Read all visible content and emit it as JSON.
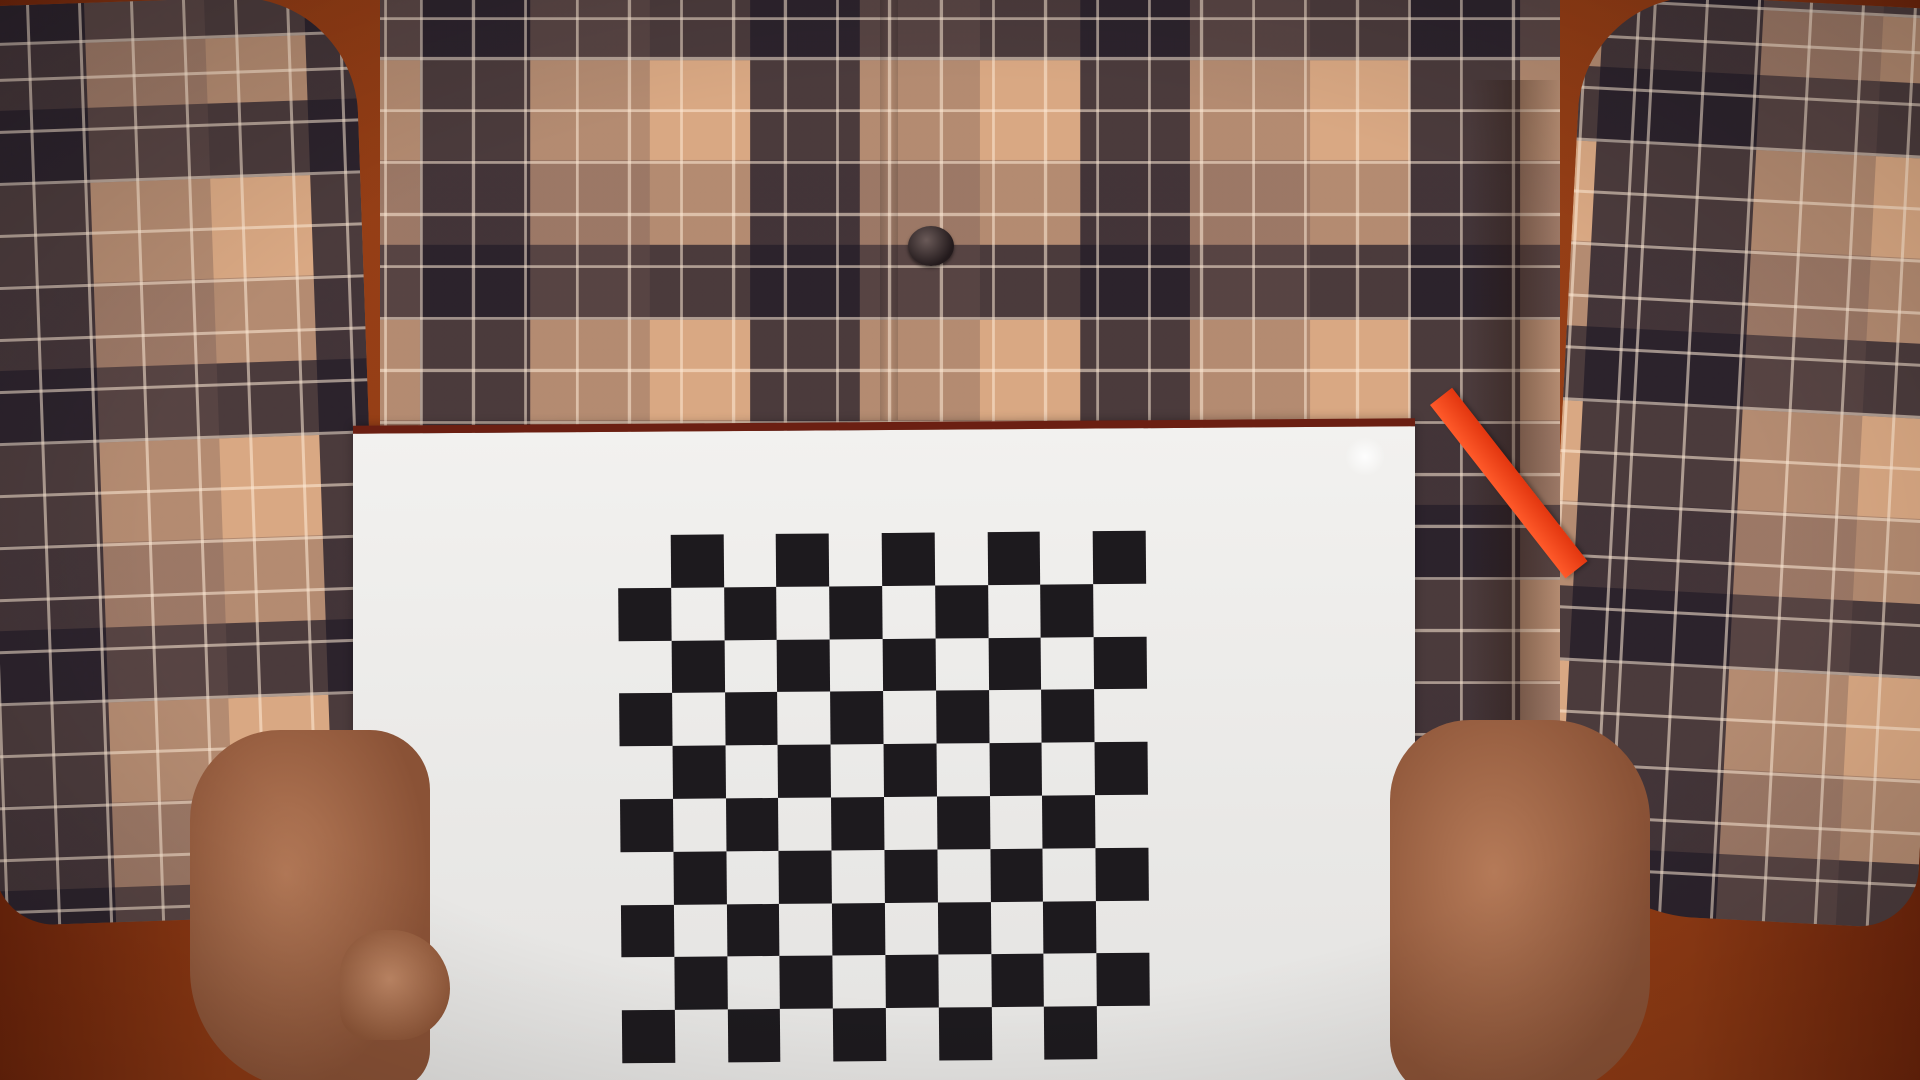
{
  "scene": {
    "subject": "person-holding-checkerboard",
    "colors": {
      "wall": "#9c4318",
      "shirt_base": "#d9a883",
      "shirt_dark": "#231c28",
      "skin": "#b57a58",
      "board": "#ececea",
      "board_edge": "#6b1f12",
      "checker_dark": "#1d1a1e",
      "bookmark": "#ff5a2a"
    },
    "checkerboard": {
      "rows": 10,
      "cols": 10
    }
  }
}
